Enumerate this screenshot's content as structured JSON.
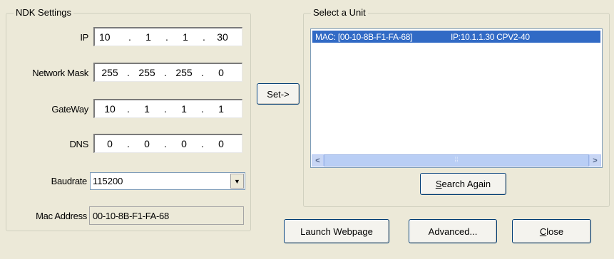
{
  "ndk": {
    "title": "NDK Settings",
    "ip": {
      "label": "IP",
      "octets": [
        "10",
        "1",
        "1",
        "30"
      ]
    },
    "mask": {
      "label": "Network Mask",
      "octets": [
        "255",
        "255",
        "255",
        "0"
      ]
    },
    "gateway": {
      "label": "GateWay",
      "octets": [
        "10",
        "1",
        "1",
        "1"
      ]
    },
    "dns": {
      "label": "DNS",
      "octets": [
        "0",
        "0",
        "0",
        "0"
      ]
    },
    "baud": {
      "label": "Baudrate",
      "value": "115200"
    },
    "mac": {
      "label": "Mac Address",
      "value": "00-10-8B-F1-FA-68"
    }
  },
  "set_button": "Set->",
  "unit": {
    "title": "Select a Unit",
    "items": [
      {
        "mac": "MAC: [00-10-8B-F1-FA-68]",
        "ip": "IP:10.1.1.30 CPV2-40"
      }
    ],
    "search_prefix": "S",
    "search_rest": "earch Again"
  },
  "footer": {
    "launch": "Launch Webpage",
    "advanced": "Advanced...",
    "close_prefix": "C",
    "close_rest": "lose"
  },
  "icons": {
    "dropdown": "chevron-down-icon",
    "scroll_left": "arrow-left-icon",
    "scroll_right": "arrow-right-icon"
  }
}
